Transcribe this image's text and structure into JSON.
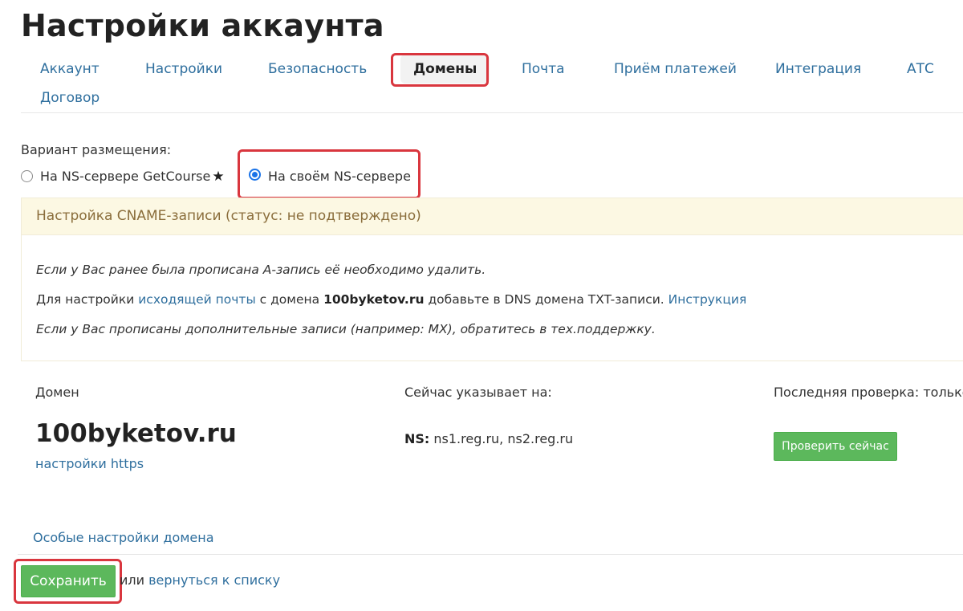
{
  "page": {
    "title": "Настройки аккаунта"
  },
  "tabs": [
    {
      "label": "Аккаунт"
    },
    {
      "label": "Настройки"
    },
    {
      "label": "Безопасность"
    },
    {
      "label": "Домены"
    },
    {
      "label": "Почта"
    },
    {
      "label": "Приём платежей"
    },
    {
      "label": "Интеграция"
    },
    {
      "label": "АТС"
    },
    {
      "label": "Договор"
    }
  ],
  "active_tab": "Домены",
  "hosting": {
    "label": "Вариант размещения:",
    "options": [
      {
        "label": "На NS-сервере GetCourse",
        "checked": false,
        "icon": "star-icon"
      },
      {
        "label": "На своём NS-сервере",
        "checked": true
      }
    ]
  },
  "cname": {
    "title": "Настройка CNAME-записи (статус: не подтверждено)",
    "line1": "Если у Вас ранее была прописана А-запись её необходимо удалить.",
    "line2": {
      "prefix": "Для настройки ",
      "mail_link": "исходящей почты",
      "middle": " с домена ",
      "domain": "100byketov.ru",
      "suffix": " добавьте в DNS домена TXT-записи. ",
      "instruction_link": "Инструкция"
    },
    "line3": "Если у Вас прописаны дополнительные записи (например: MX), обратитесь в тех.поддержку."
  },
  "domain_table": {
    "headers": {
      "domain": "Домен",
      "points_to": "Сейчас указывает на:",
      "last_check": "Последняя проверка: только"
    },
    "row": {
      "domain": "100byketov.ru",
      "https_link": "настройки https",
      "ns_label": "NS:",
      "ns_value": " ns1.reg.ru, ns2.reg.ru",
      "check_button": "Проверить сейчас"
    }
  },
  "special_settings_link": "Особые настройки домена",
  "footer": {
    "save_button": "Сохранить",
    "or_text": "или ",
    "back_link": "вернуться к списку"
  },
  "colors": {
    "link": "#2f6f9e",
    "button_green": "#5cb85c",
    "highlight_red": "#d9363e",
    "warning_bg": "#fcf8e3",
    "warning_text": "#8a6d3b",
    "radio_blue": "#1a73e8"
  }
}
